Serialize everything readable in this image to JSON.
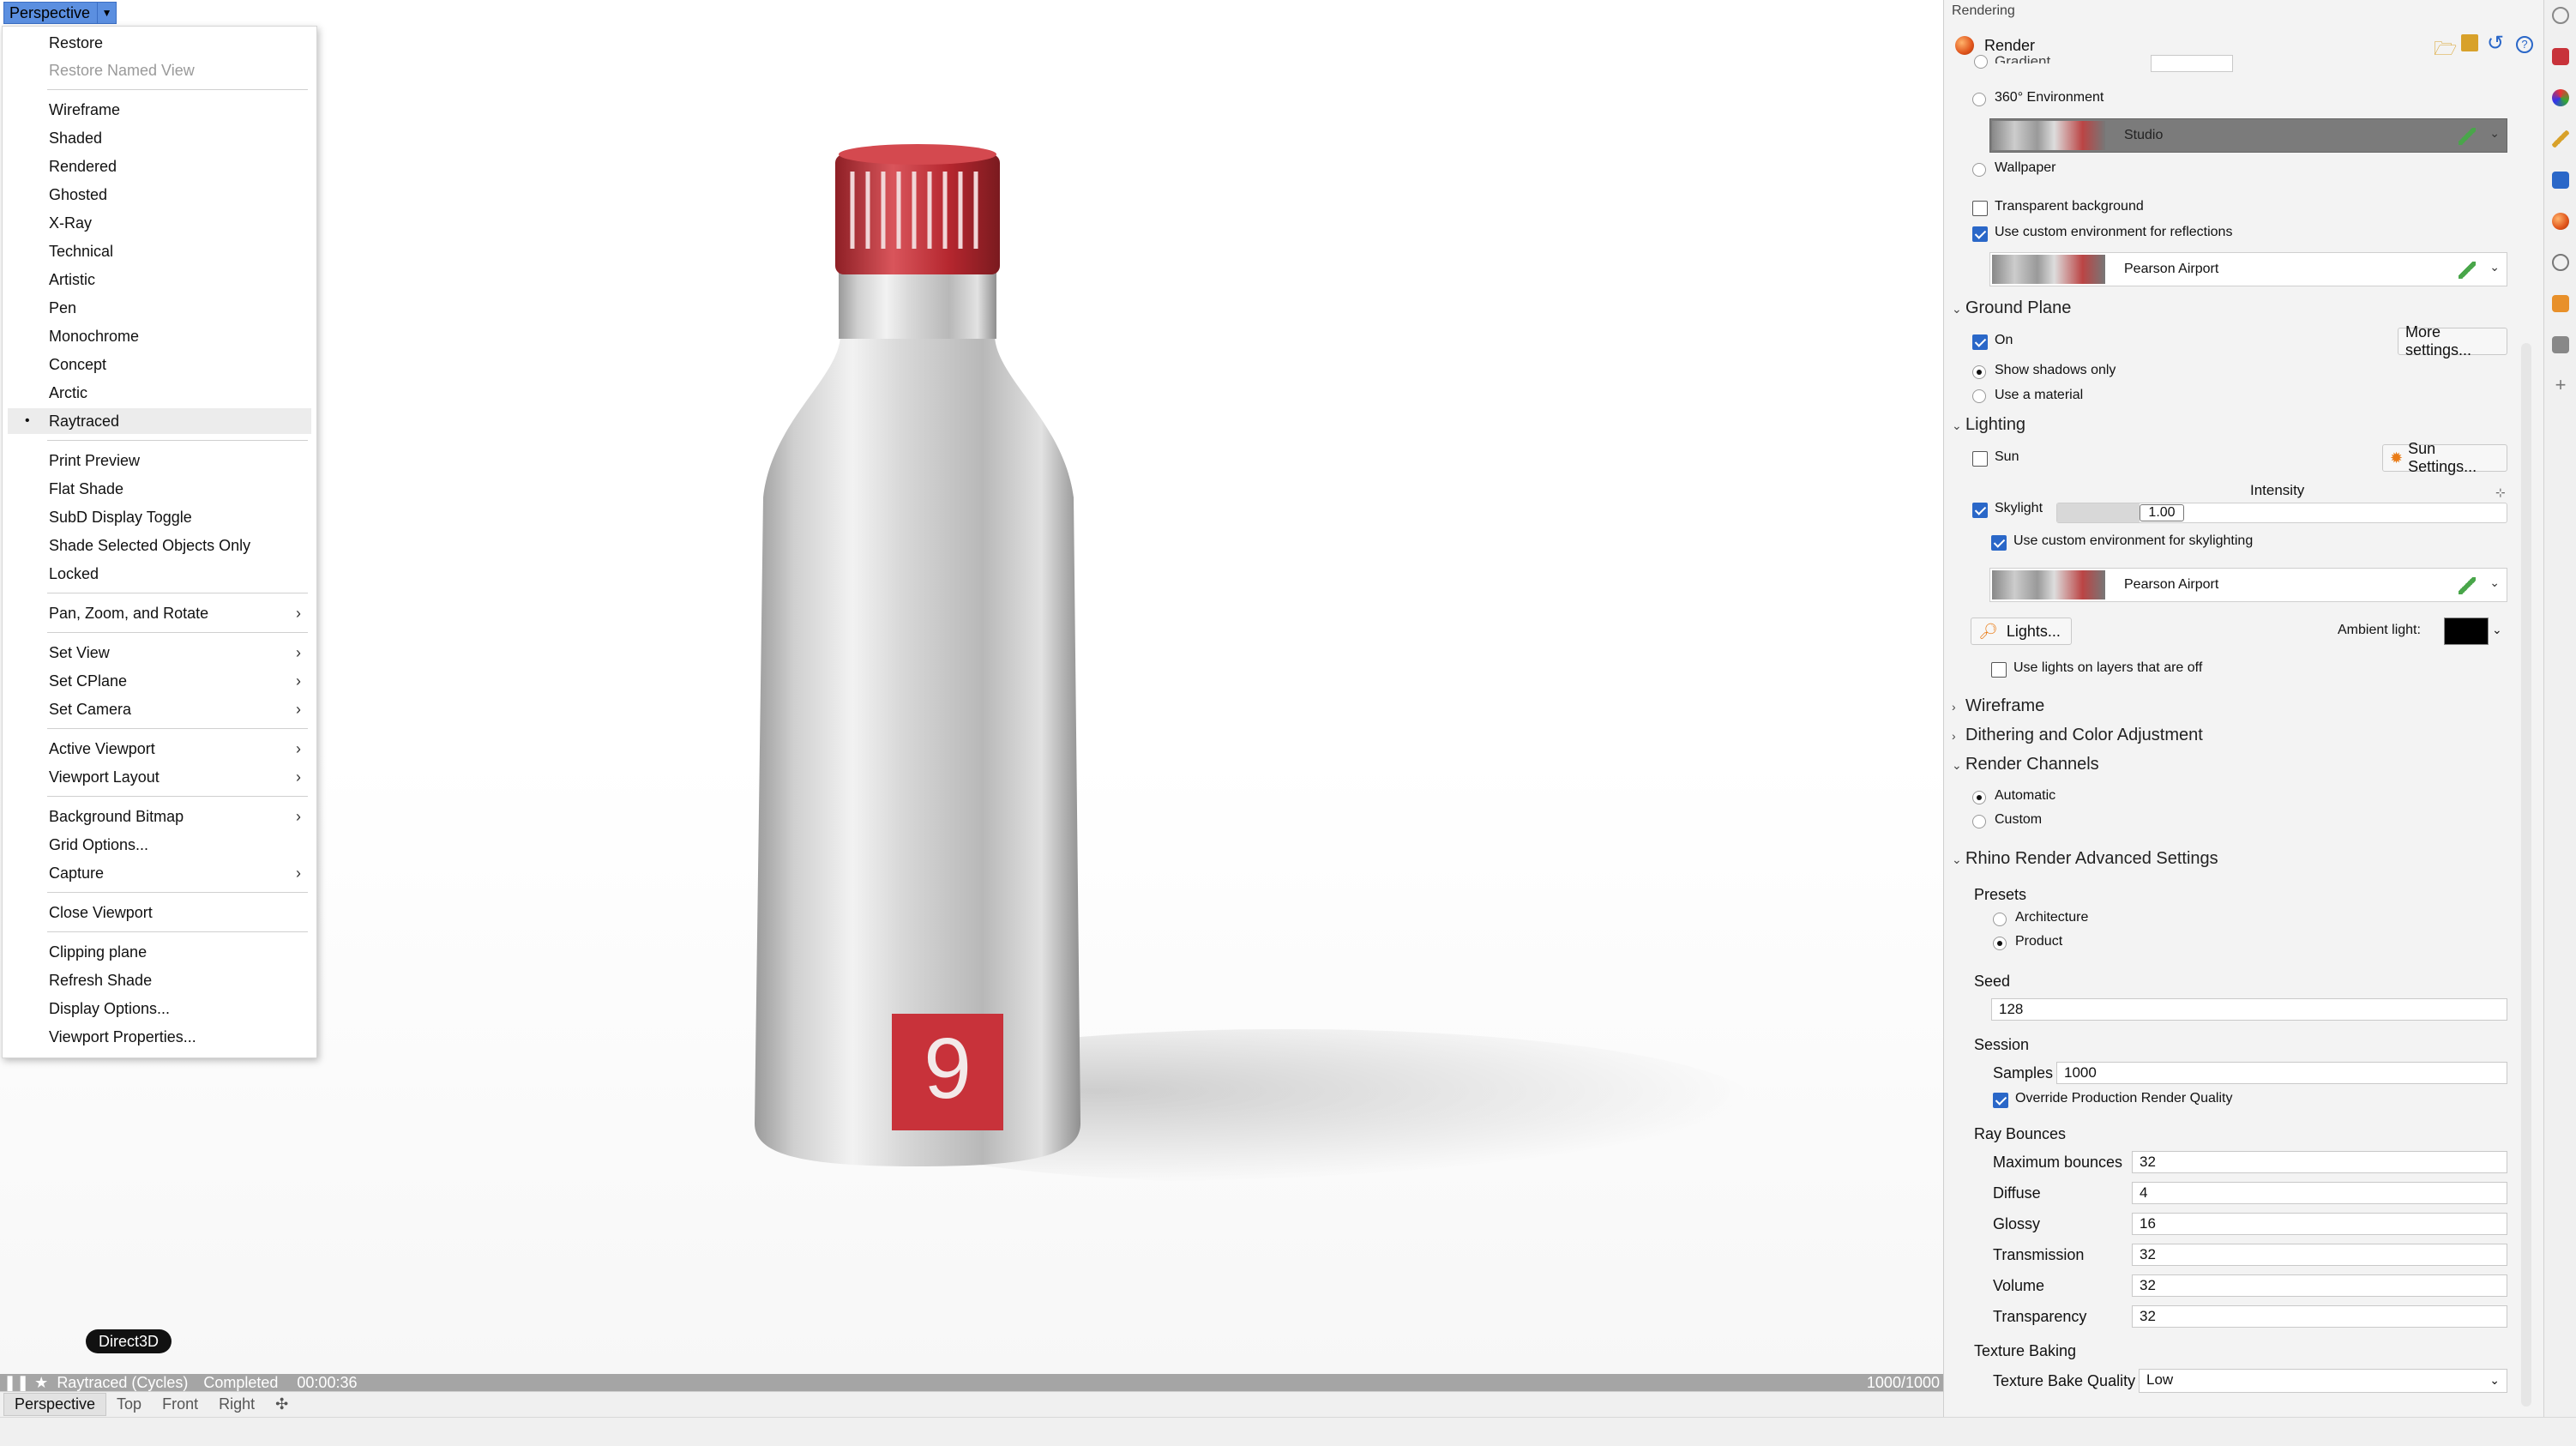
{
  "viewport": {
    "title": "Perspective",
    "driver_badge": "Direct3D",
    "status": {
      "mode": "Raytraced (Cycles)",
      "state": "Completed",
      "time": "00:00:36",
      "passes": "1000/1000"
    },
    "tabs": [
      "Perspective",
      "Top",
      "Front",
      "Right"
    ],
    "bottle_logo": "9"
  },
  "menu": {
    "items": [
      {
        "label": "Restore"
      },
      {
        "label": "Restore Named View"
      },
      {
        "label": "Wireframe"
      },
      {
        "label": "Shaded"
      },
      {
        "label": "Rendered"
      },
      {
        "label": "Ghosted"
      },
      {
        "label": "X-Ray"
      },
      {
        "label": "Technical"
      },
      {
        "label": "Artistic"
      },
      {
        "label": "Pen"
      },
      {
        "label": "Monochrome"
      },
      {
        "label": "Concept"
      },
      {
        "label": "Arctic"
      },
      {
        "label": "Raytraced"
      },
      {
        "label": "Print Preview"
      },
      {
        "label": "Flat Shade"
      },
      {
        "label": "SubD Display Toggle"
      },
      {
        "label": "Shade Selected Objects Only"
      },
      {
        "label": "Locked"
      },
      {
        "label": "Pan, Zoom, and Rotate"
      },
      {
        "label": "Set View"
      },
      {
        "label": "Set CPlane"
      },
      {
        "label": "Set Camera"
      },
      {
        "label": "Active Viewport"
      },
      {
        "label": "Viewport Layout"
      },
      {
        "label": "Background Bitmap"
      },
      {
        "label": "Grid Options..."
      },
      {
        "label": "Capture"
      },
      {
        "label": "Close Viewport"
      },
      {
        "label": "Clipping plane"
      },
      {
        "label": "Refresh Shade"
      },
      {
        "label": "Display Options..."
      },
      {
        "label": "Viewport Properties..."
      }
    ]
  },
  "panel": {
    "title": "Rendering",
    "render_label": "Render",
    "background": {
      "gradient_label": "Gradient",
      "env360_label": "360° Environment",
      "env360_value": "Studio",
      "wallpaper_label": "Wallpaper",
      "transparent_label": "Transparent background",
      "custom_reflect_label": "Use custom environment for reflections",
      "reflect_env": "Pearson Airport"
    },
    "ground_plane": {
      "title": "Ground Plane",
      "on_label": "On",
      "more_settings": "More settings...",
      "shadows_only": "Show shadows only",
      "use_material": "Use a material"
    },
    "lighting": {
      "title": "Lighting",
      "sun_label": "Sun",
      "sun_settings": "Sun Settings...",
      "intensity_label": "Intensity",
      "skylight_label": "Skylight",
      "skylight_value": "1.00",
      "custom_sky_label": "Use custom environment for skylighting",
      "sky_env": "Pearson Airport",
      "lights_button": "Lights...",
      "ambient_label": "Ambient light:",
      "layers_off_label": "Use lights on layers that are off"
    },
    "wireframe_title": "Wireframe",
    "dithering_title": "Dithering and Color Adjustment",
    "render_channels": {
      "title": "Render Channels",
      "automatic": "Automatic",
      "custom": "Custom"
    },
    "advanced": {
      "title": "Rhino Render Advanced Settings",
      "presets_label": "Presets",
      "architecture": "Architecture",
      "product": "Product",
      "seed_label": "Seed",
      "seed_value": "128",
      "session_label": "Session",
      "samples_label": "Samples",
      "samples_value": "1000",
      "override_label": "Override Production Render Quality",
      "ray_bounces_label": "Ray Bounces",
      "bounces": [
        {
          "label": "Maximum bounces",
          "value": "32"
        },
        {
          "label": "Diffuse",
          "value": "4"
        },
        {
          "label": "Glossy",
          "value": "16"
        },
        {
          "label": "Transmission",
          "value": "32"
        },
        {
          "label": "Volume",
          "value": "32"
        },
        {
          "label": "Transparency",
          "value": "32"
        }
      ],
      "texture_baking_label": "Texture Baking",
      "bake_quality_label": "Texture Bake Quality",
      "bake_quality_value": "Low"
    }
  },
  "colors": {
    "accent": "#2a67c8",
    "title_highlight": "#5b8fe0",
    "bottle_cap": "#c8323a"
  }
}
